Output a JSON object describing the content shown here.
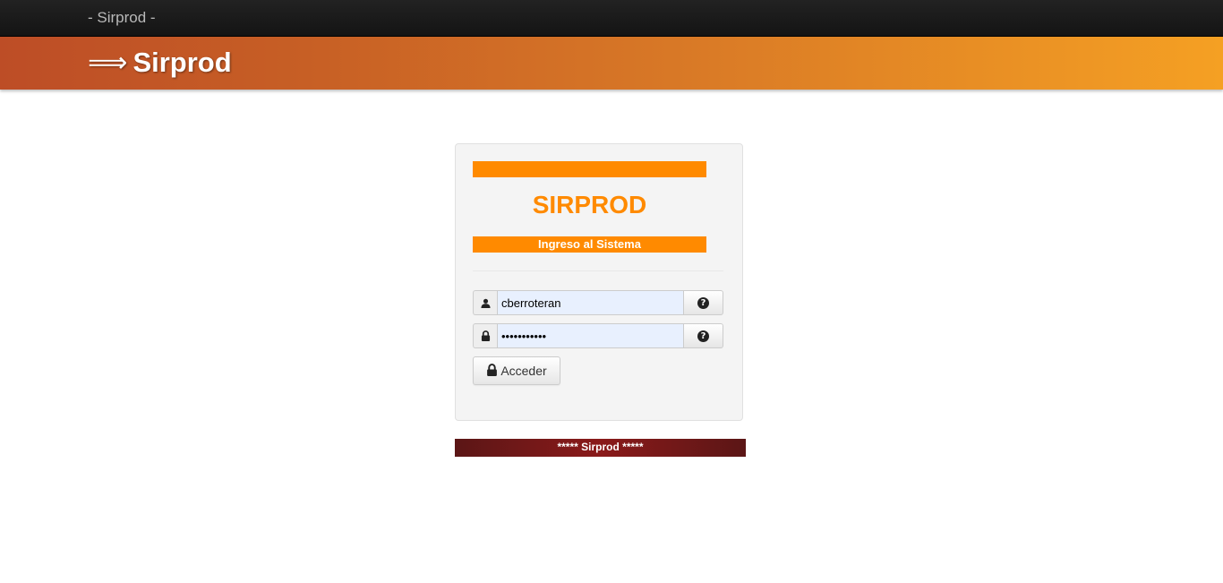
{
  "topbar": {
    "brand": "- Sirprod -"
  },
  "banner": {
    "arrow": "⟹",
    "title": "Sirprod"
  },
  "login": {
    "top_bar_color": "#ff8a00",
    "logo_text": "SIRPROD",
    "subtitle": "Ingreso al Sistema",
    "username": {
      "value": "cberroteran",
      "icon": "user-icon",
      "help_icon": "question-circle-icon"
    },
    "password": {
      "value": "•••••••••••",
      "icon": "lock-icon",
      "help_icon": "question-circle-icon"
    },
    "submit": {
      "label": "Acceder",
      "icon": "lock-icon"
    },
    "help_glyph": "?"
  },
  "footer": {
    "text": "***** Sirprod *****"
  },
  "colors": {
    "accent_orange": "#ff8a00",
    "banner_start": "#bd4d26",
    "banner_end": "#f5a023",
    "footer_red": "#8a1a1a"
  }
}
